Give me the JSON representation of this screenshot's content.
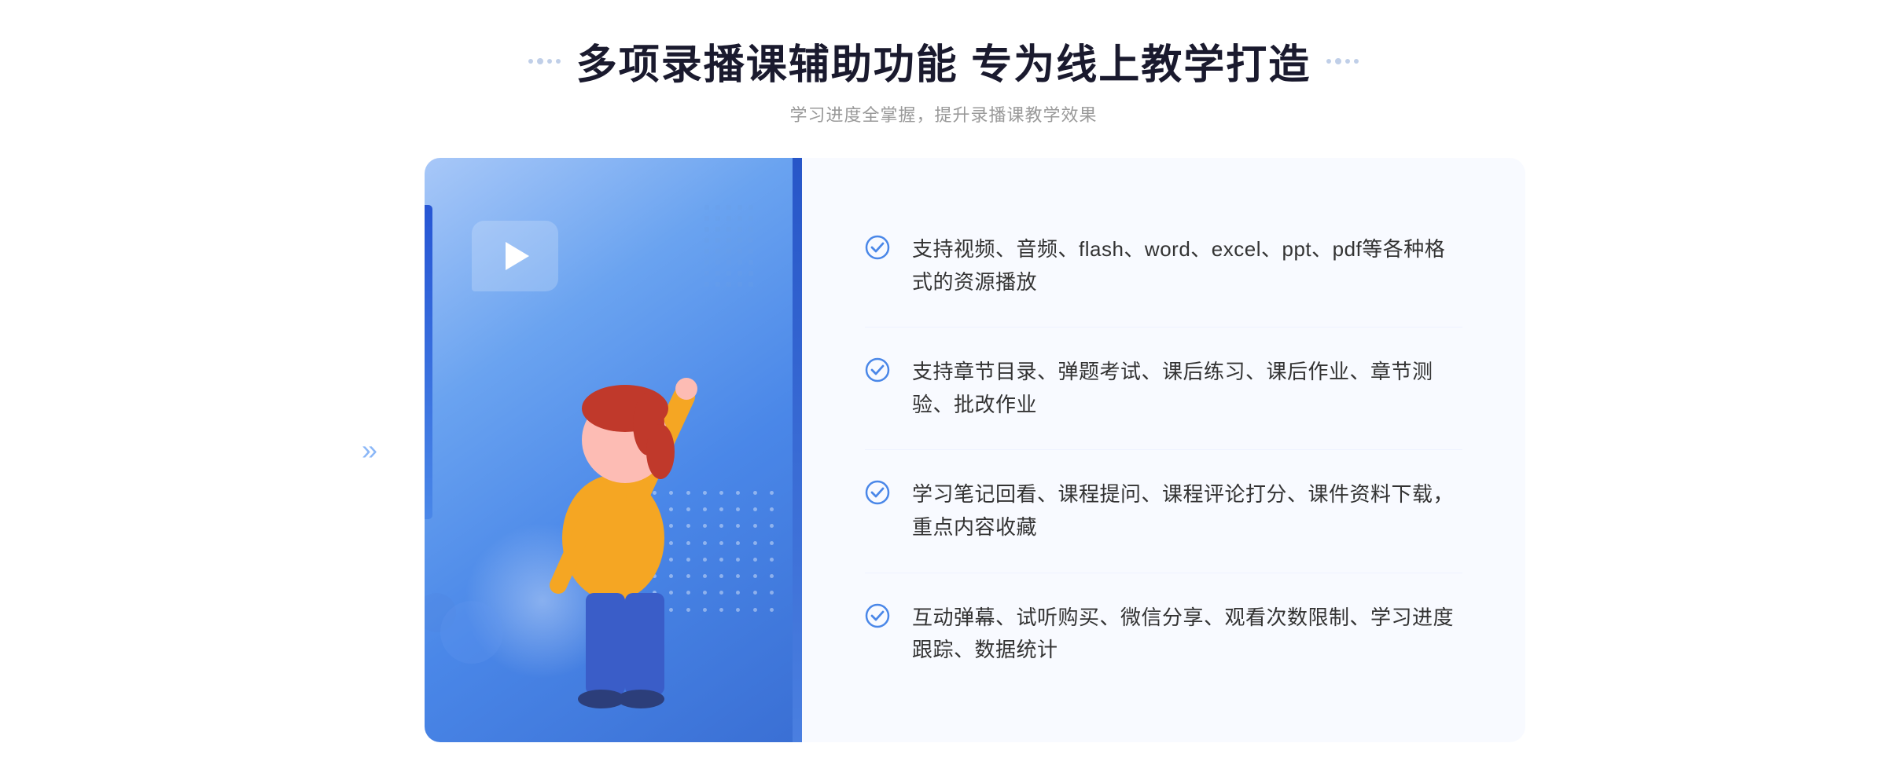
{
  "header": {
    "title": "多项录播课辅助功能 专为线上教学打造",
    "subtitle": "学习进度全掌握，提升录播课教学效果"
  },
  "features": [
    {
      "id": 1,
      "text": "支持视频、音频、flash、word、excel、ppt、pdf等各种格式的资源播放"
    },
    {
      "id": 2,
      "text": "支持章节目录、弹题考试、课后练习、课后作业、章节测验、批改作业"
    },
    {
      "id": 3,
      "text": "学习笔记回看、课程提问、课程评论打分、课件资料下载，重点内容收藏"
    },
    {
      "id": 4,
      "text": "互动弹幕、试听购买、微信分享、观看次数限制、学习进度跟踪、数据统计"
    }
  ],
  "decoration": {
    "left_arrow": "»",
    "check_color": "#4a87e8"
  }
}
